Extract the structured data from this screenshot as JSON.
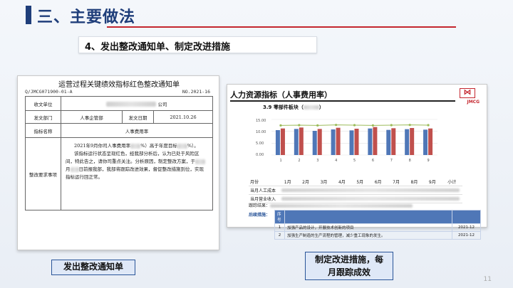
{
  "page": {
    "title": "三、主要做法",
    "subtitle": "4、发出整改通知单、制定改进措施",
    "page_number": "11"
  },
  "notice": {
    "title": "运营过程关键绩效指标红色整改通知单",
    "code": "Q/JMCG071900-01-A",
    "number": "NO.2021-16",
    "rows": {
      "recv_unit_label": "收文单位",
      "recv_unit_value": "公司",
      "send_dept_label": "发文部门",
      "send_dept_value": "人事企管部",
      "send_date_label": "发文日期",
      "send_date_value": "2021.10.26",
      "indicator_label": "指标名称",
      "indicator_value": "人事费用率",
      "req_label": "整改要求事项",
      "req_line1": "2021年9月你司人事费用率",
      "req_line1b": "%）高于年度目标",
      "req_line1c": "%）。",
      "req_line2": "该指标运行状态呈现红色，经我部分析后，认为已处于风险区间，特此告之，请你司重点关注。分析原因，制定整改方案，于",
      "req_line3": "月",
      "req_line3b": "日前报我部，我部将跟踪改进效果，督促整改措施到位，实现指标运行回正常。"
    }
  },
  "report": {
    "heading": "人力资源指标（人事费用率）",
    "logo_text": "JMCG",
    "section": "3.9 零部件板块（",
    "section_end": "）",
    "y_ticks": [
      "15.00",
      "10.00",
      "5.00",
      "0.00"
    ],
    "x_labels": [
      "1",
      "2",
      "3",
      "4",
      "5",
      "6",
      "7",
      "8",
      "9"
    ],
    "table_header": [
      "月份",
      "1月",
      "2月",
      "3月",
      "4月",
      "5月",
      "6月",
      "7月",
      "8月",
      "9月",
      "小计"
    ],
    "table_rows": [
      "当月人工成本",
      "当月营业收入"
    ],
    "track_label": "跟踪结果：",
    "measure_label": "后续措施：",
    "measure_header": [
      "序号",
      "",
      ""
    ],
    "measures": [
      {
        "no": "1",
        "text": "加强产品的设计，开展技术创新的项目",
        "date": "2021-12"
      },
      {
        "no": "2",
        "text": "加强生产制造的生产流程的管理，减少重工现象的发生。",
        "date": "2021-12"
      }
    ]
  },
  "captions": {
    "left": "发出整改通知单",
    "right_line1": "制定改进措施，每",
    "right_line2": "月跟踪成效"
  },
  "chart_data": {
    "type": "bar",
    "categories": [
      "1",
      "2",
      "3",
      "4",
      "5",
      "6",
      "7",
      "8",
      "9"
    ],
    "ylim": [
      0,
      15
    ],
    "series": [
      {
        "values": [
          10.5,
          11.0,
          10.2,
          10.8,
          10.4,
          11.2,
          10.6,
          10.9,
          10.7
        ],
        "color": "#4f77b7"
      },
      {
        "values": [
          11.2,
          11.6,
          11.0,
          11.5,
          11.1,
          11.8,
          11.3,
          11.4,
          11.2
        ],
        "color": "#c0504d"
      }
    ],
    "line": {
      "values": [
        12.5,
        12.6,
        12.5,
        12.7,
        12.6,
        12.5,
        12.6,
        12.7,
        12.6
      ],
      "color": "#9bbb59"
    }
  }
}
